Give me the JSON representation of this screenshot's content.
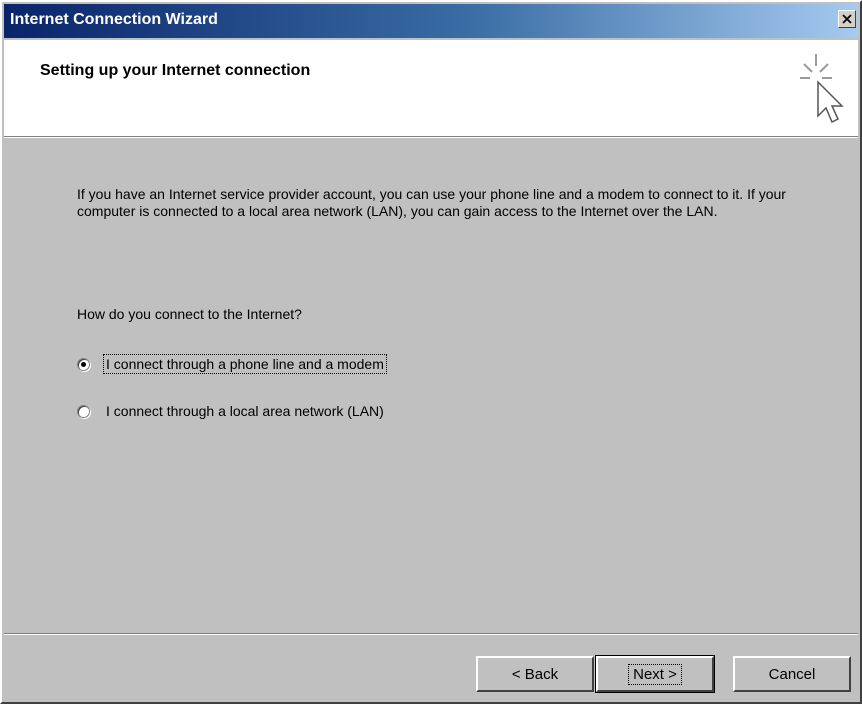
{
  "window": {
    "title": "Internet Connection Wizard"
  },
  "header": {
    "title": "Setting up your Internet connection",
    "icon": "wizard-cursor-icon"
  },
  "content": {
    "intro": "If you have an Internet service provider account, you can use your phone line and a modem to connect to it. If your computer is connected to a local area network (LAN), you can gain access to the Internet over the LAN.",
    "question": "How do you connect to the Internet?",
    "options": [
      {
        "label": "I connect through a phone line and a modem",
        "selected": true
      },
      {
        "label": "I connect through a local area network (LAN)",
        "selected": false
      }
    ]
  },
  "buttons": {
    "back": "< Back",
    "next": "Next >",
    "cancel": "Cancel"
  }
}
